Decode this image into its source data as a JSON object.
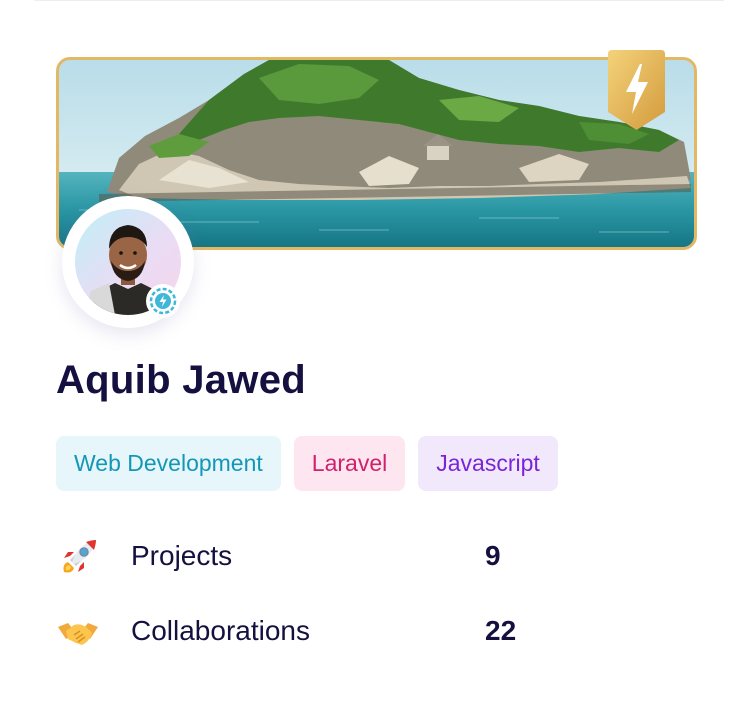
{
  "profile": {
    "name": "Aquib Jawed",
    "verified_icon": "verified-badge-icon",
    "badge_icon": "lightning-bolt-icon"
  },
  "cover": {
    "image": "island-landscape-photo"
  },
  "tags": [
    {
      "label": "Web Development",
      "color": "#1497b7",
      "bg": "#e6f6fb"
    },
    {
      "label": "Laravel",
      "color": "#d1206c",
      "bg": "#fde6f0"
    },
    {
      "label": "Javascript",
      "color": "#7a24d6",
      "bg": "#f2e8fc"
    }
  ],
  "stats": [
    {
      "icon": "rocket-icon",
      "label": "Projects",
      "value": "9"
    },
    {
      "icon": "handshake-icon",
      "label": "Collaborations",
      "value": "22"
    }
  ],
  "colors": {
    "name_text": "#14103f",
    "badge_gold": "#e2b865"
  }
}
